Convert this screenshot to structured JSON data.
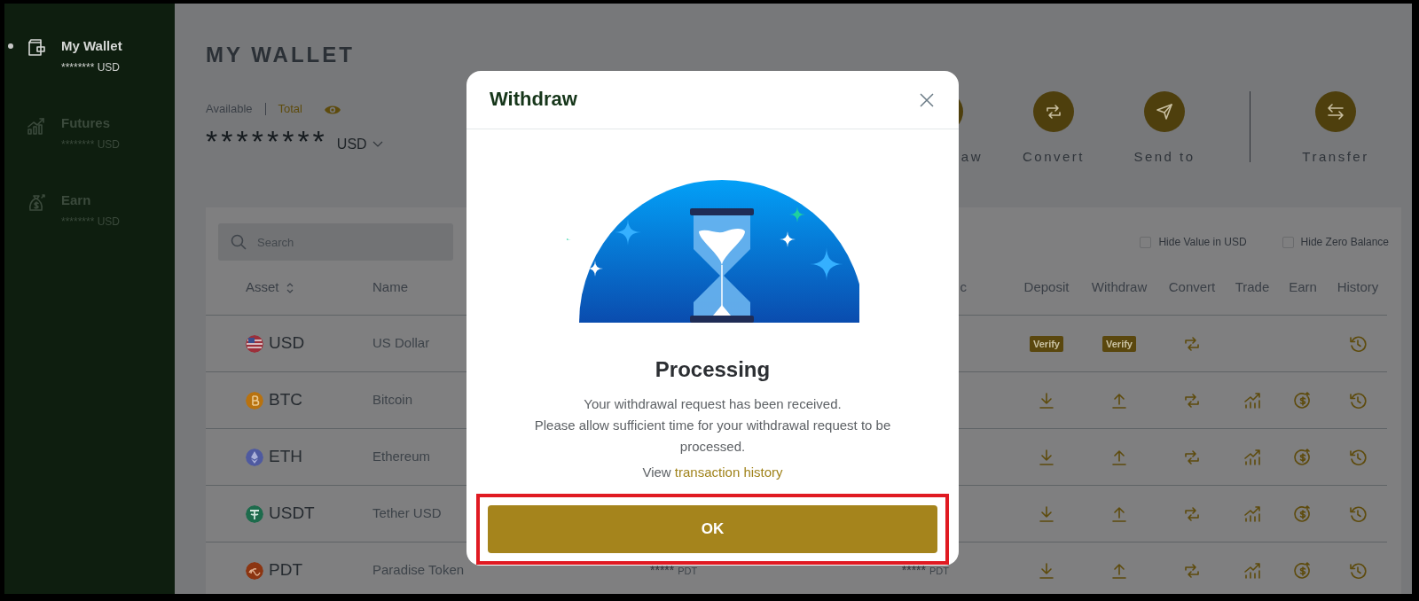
{
  "sidebar": {
    "items": [
      {
        "label": "My Wallet",
        "amount": "******** USD",
        "kind": "wallet",
        "selected": true
      },
      {
        "label": "Futures",
        "amount": "******** USD",
        "kind": "futures",
        "selected": false
      },
      {
        "label": "Earn",
        "amount": "******** USD",
        "kind": "earn",
        "selected": false
      }
    ]
  },
  "page_title": "MY WALLET",
  "balance": {
    "tabs": [
      {
        "label": "Available",
        "selected": false
      },
      {
        "label": "Total",
        "selected": true
      }
    ],
    "amount": "********",
    "currency": "USD"
  },
  "actions": [
    {
      "label": "aw"
    },
    {
      "label": "Convert",
      "kind": "convert"
    },
    {
      "label": "Send to",
      "kind": "send"
    }
  ],
  "transfer_action": {
    "label": "Transfer",
    "kind": "transfer"
  },
  "search": {
    "placeholder": "Search"
  },
  "filters": [
    {
      "label": "Hide Value in USD",
      "checked": false
    },
    {
      "label": "Hide Zero Balance",
      "checked": false
    }
  ],
  "table": {
    "columns": [
      "Asset",
      "Name",
      "c",
      "Deposit",
      "Withdraw",
      "Convert",
      "Trade",
      "Earn",
      "History"
    ],
    "rows": [
      {
        "asset": "USD",
        "kind": "flag",
        "color": "#9c2f3a",
        "name": "US Dollar",
        "actions": [
          {
            "kind": "verify",
            "label": "Verify"
          },
          {
            "kind": "verify",
            "label": "Verify"
          },
          {
            "kind": "convert"
          },
          {
            "kind": "blank"
          },
          {
            "kind": "blank"
          },
          {
            "kind": "history"
          }
        ]
      },
      {
        "asset": "BTC",
        "kind": "bitcoin",
        "color": "#b8720f",
        "name": "Bitcoin",
        "actions": [
          {
            "kind": "deposit"
          },
          {
            "kind": "withdraw"
          },
          {
            "kind": "convert"
          },
          {
            "kind": "trade"
          },
          {
            "kind": "earn"
          },
          {
            "kind": "history"
          }
        ]
      },
      {
        "asset": "ETH",
        "kind": "ether",
        "color": "#4f5aa0",
        "name": "Ethereum",
        "actions": [
          {
            "kind": "deposit"
          },
          {
            "kind": "withdraw"
          },
          {
            "kind": "convert"
          },
          {
            "kind": "trade"
          },
          {
            "kind": "earn"
          },
          {
            "kind": "history"
          }
        ]
      },
      {
        "asset": "USDT",
        "kind": "tether",
        "color": "#1d6b4c",
        "name": "Tether USD",
        "actions": [
          {
            "kind": "deposit"
          },
          {
            "kind": "withdraw"
          },
          {
            "kind": "convert"
          },
          {
            "kind": "trade"
          },
          {
            "kind": "earn"
          },
          {
            "kind": "history"
          }
        ]
      },
      {
        "asset": "PDT",
        "kind": "token",
        "color": "#8c3511",
        "name": "Paradise Token",
        "column_3": {
          "value": "*****",
          "unit": "PDT"
        },
        "column_4": {
          "value": "*****",
          "unit": "PDT"
        },
        "actions": [
          {
            "kind": "deposit"
          },
          {
            "kind": "withdraw"
          },
          {
            "kind": "convert"
          },
          {
            "kind": "trade"
          },
          {
            "kind": "earn"
          },
          {
            "kind": "history"
          }
        ]
      }
    ]
  },
  "modal": {
    "title": "Withdraw",
    "heading": "Processing",
    "message": [
      "Your withdrawal request has been received.",
      "Please allow sufficient time for your withdrawal request to be processed."
    ],
    "history_note": {
      "text": "View",
      "link": "transaction history"
    },
    "ok_button": "OK",
    "highlighted": true
  }
}
